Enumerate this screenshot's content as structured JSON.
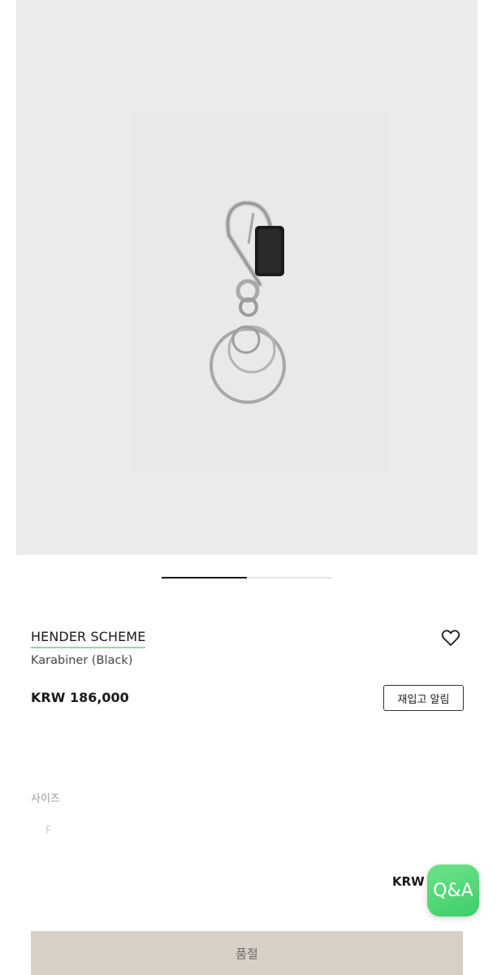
{
  "product": {
    "brand": "HENDER SCHEME",
    "name": "Karabiner (Black)",
    "price": "KRW 186,000",
    "image_alt": "carabiner keyring",
    "gallery": {
      "current": 1,
      "total": 2
    }
  },
  "actions": {
    "restock_label": "재입고 알림",
    "soldout_label": "품절"
  },
  "options": {
    "size_label": "사이즈",
    "size_values": [
      "F"
    ]
  },
  "total": {
    "price": "KRW 0"
  },
  "qa": {
    "label": "Q&A"
  },
  "icons": {
    "wishlist": "heart-icon"
  },
  "colors": {
    "brand_underline": "#9bd7a0",
    "qa_button": "#4fd777",
    "soldout_bg": "#d8cfc7"
  }
}
